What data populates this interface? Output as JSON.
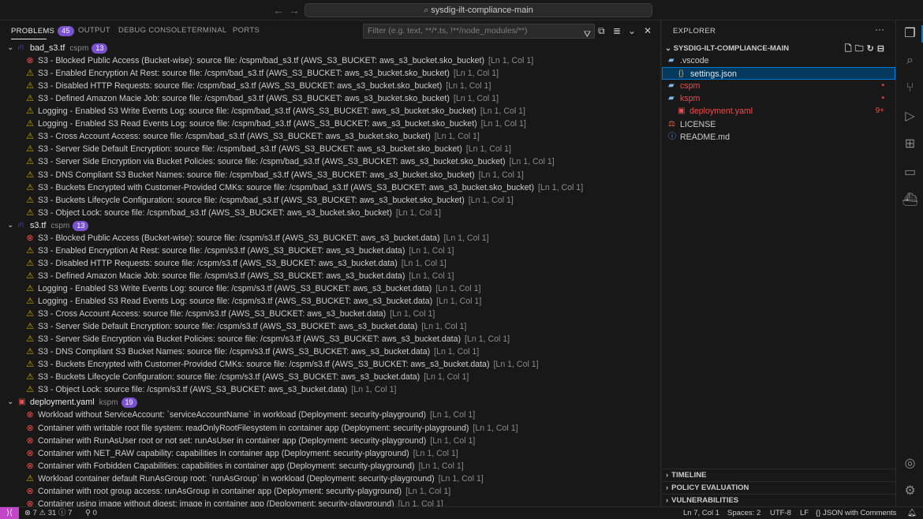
{
  "title_bar": {
    "back_label": "←",
    "forward_label": "→",
    "search_text": "sysdig-ilt-compliance-main"
  },
  "panel": {
    "tabs": [
      {
        "label": "PROBLEMS",
        "badge": "45"
      },
      {
        "label": "OUTPUT"
      },
      {
        "label": "DEBUG CONSOLE"
      },
      {
        "label": "TERMINAL"
      },
      {
        "label": "PORTS"
      }
    ],
    "filter_placeholder": "Filter (e.g. text, **/*.ts, !**/node_modules/**)",
    "groups": [
      {
        "file": "bad_s3.tf",
        "dir": "cspm",
        "count": "13",
        "items": [
          {
            "severity": "error",
            "message": "S3 - Blocked Public Access (Bucket-wise): source file: /cspm/bad_s3.tf (AWS_S3_BUCKET: aws_s3_bucket.sko_bucket)",
            "location": "[Ln 1, Col 1]"
          },
          {
            "severity": "warning",
            "message": "S3 - Enabled Encryption At Rest: source file: /cspm/bad_s3.tf (AWS_S3_BUCKET: aws_s3_bucket.sko_bucket)",
            "location": "[Ln 1, Col 1]"
          },
          {
            "severity": "warning",
            "message": "S3 - Disabled HTTP Requests: source file: /cspm/bad_s3.tf (AWS_S3_BUCKET: aws_s3_bucket.sko_bucket)",
            "location": "[Ln 1, Col 1]"
          },
          {
            "severity": "warning",
            "message": "S3 - Defined Amazon Macie Job: source file: /cspm/bad_s3.tf (AWS_S3_BUCKET: aws_s3_bucket.sko_bucket)",
            "location": "[Ln 1, Col 1]"
          },
          {
            "severity": "warning",
            "message": "Logging - Enabled S3 Write Events Log: source file: /cspm/bad_s3.tf (AWS_S3_BUCKET: aws_s3_bucket.sko_bucket)",
            "location": "[Ln 1, Col 1]"
          },
          {
            "severity": "warning",
            "message": "Logging - Enabled S3 Read Events Log: source file: /cspm/bad_s3.tf (AWS_S3_BUCKET: aws_s3_bucket.sko_bucket)",
            "location": "[Ln 1, Col 1]"
          },
          {
            "severity": "warning",
            "message": "S3 - Cross Account Access: source file: /cspm/bad_s3.tf (AWS_S3_BUCKET: aws_s3_bucket.sko_bucket)",
            "location": "[Ln 1, Col 1]"
          },
          {
            "severity": "warning",
            "message": "S3 - Server Side Default Encryption: source file: /cspm/bad_s3.tf (AWS_S3_BUCKET: aws_s3_bucket.sko_bucket)",
            "location": "[Ln 1, Col 1]"
          },
          {
            "severity": "warning",
            "message": "S3 - Server Side Encryption via Bucket Policies: source file: /cspm/bad_s3.tf (AWS_S3_BUCKET: aws_s3_bucket.sko_bucket)",
            "location": "[Ln 1, Col 1]"
          },
          {
            "severity": "warning",
            "message": "S3 - DNS Compliant S3 Bucket Names: source file: /cspm/bad_s3.tf (AWS_S3_BUCKET: aws_s3_bucket.sko_bucket)",
            "location": "[Ln 1, Col 1]"
          },
          {
            "severity": "warning",
            "message": "S3 - Buckets Encrypted with Customer-Provided CMKs: source file: /cspm/bad_s3.tf (AWS_S3_BUCKET: aws_s3_bucket.sko_bucket)",
            "location": "[Ln 1, Col 1]"
          },
          {
            "severity": "warning",
            "message": "S3 - Buckets Lifecycle Configuration: source file: /cspm/bad_s3.tf (AWS_S3_BUCKET: aws_s3_bucket.sko_bucket)",
            "location": "[Ln 1, Col 1]"
          },
          {
            "severity": "warning",
            "message": "S3 - Object Lock: source file: /cspm/bad_s3.tf (AWS_S3_BUCKET: aws_s3_bucket.sko_bucket)",
            "location": "[Ln 1, Col 1]"
          }
        ]
      },
      {
        "file": "s3.tf",
        "dir": "cspm",
        "count": "13",
        "items": [
          {
            "severity": "error",
            "message": "S3 - Blocked Public Access (Bucket-wise): source file: /cspm/s3.tf (AWS_S3_BUCKET: aws_s3_bucket.data)",
            "location": "[Ln 1, Col 1]"
          },
          {
            "severity": "warning",
            "message": "S3 - Enabled Encryption At Rest: source file: /cspm/s3.tf (AWS_S3_BUCKET: aws_s3_bucket.data)",
            "location": "[Ln 1, Col 1]"
          },
          {
            "severity": "warning",
            "message": "S3 - Disabled HTTP Requests: source file: /cspm/s3.tf (AWS_S3_BUCKET: aws_s3_bucket.data)",
            "location": "[Ln 1, Col 1]"
          },
          {
            "severity": "warning",
            "message": "S3 - Defined Amazon Macie Job: source file: /cspm/s3.tf (AWS_S3_BUCKET: aws_s3_bucket.data)",
            "location": "[Ln 1, Col 1]"
          },
          {
            "severity": "warning",
            "message": "Logging - Enabled S3 Write Events Log: source file: /cspm/s3.tf (AWS_S3_BUCKET: aws_s3_bucket.data)",
            "location": "[Ln 1, Col 1]"
          },
          {
            "severity": "warning",
            "message": "Logging - Enabled S3 Read Events Log: source file: /cspm/s3.tf (AWS_S3_BUCKET: aws_s3_bucket.data)",
            "location": "[Ln 1, Col 1]"
          },
          {
            "severity": "warning",
            "message": "S3 - Cross Account Access: source file: /cspm/s3.tf (AWS_S3_BUCKET: aws_s3_bucket.data)",
            "location": "[Ln 1, Col 1]"
          },
          {
            "severity": "warning",
            "message": "S3 - Server Side Default Encryption: source file: /cspm/s3.tf (AWS_S3_BUCKET: aws_s3_bucket.data)",
            "location": "[Ln 1, Col 1]"
          },
          {
            "severity": "warning",
            "message": "S3 - Server Side Encryption via Bucket Policies: source file: /cspm/s3.tf (AWS_S3_BUCKET: aws_s3_bucket.data)",
            "location": "[Ln 1, Col 1]"
          },
          {
            "severity": "warning",
            "message": "S3 - DNS Compliant S3 Bucket Names: source file: /cspm/s3.tf (AWS_S3_BUCKET: aws_s3_bucket.data)",
            "location": "[Ln 1, Col 1]"
          },
          {
            "severity": "warning",
            "message": "S3 - Buckets Encrypted with Customer-Provided CMKs: source file: /cspm/s3.tf (AWS_S3_BUCKET: aws_s3_bucket.data)",
            "location": "[Ln 1, Col 1]"
          },
          {
            "severity": "warning",
            "message": "S3 - Buckets Lifecycle Configuration: source file: /cspm/s3.tf (AWS_S3_BUCKET: aws_s3_bucket.data)",
            "location": "[Ln 1, Col 1]"
          },
          {
            "severity": "warning",
            "message": "S3 - Object Lock: source file: /cspm/s3.tf (AWS_S3_BUCKET: aws_s3_bucket.data)",
            "location": "[Ln 1, Col 1]"
          }
        ]
      },
      {
        "file": "deployment.yaml",
        "dir": "kspm",
        "count": "19",
        "items": [
          {
            "severity": "error",
            "message": "Workload without ServiceAccount: `serviceAccountName` in workload (Deployment: security-playground)",
            "location": "[Ln 1, Col 1]"
          },
          {
            "severity": "error",
            "message": "Container with writable root file system: readOnlyRootFilesystem in container app (Deployment: security-playground)",
            "location": "[Ln 1, Col 1]"
          },
          {
            "severity": "error",
            "message": "Container with RunAsUser root or not set: runAsUser in container app (Deployment: security-playground)",
            "location": "[Ln 1, Col 1]"
          },
          {
            "severity": "error",
            "message": "Container with NET_RAW capability: capabilities in container app (Deployment: security-playground)",
            "location": "[Ln 1, Col 1]"
          },
          {
            "severity": "error",
            "message": "Container with Forbidden Capabilities: capabilities in container app (Deployment: security-playground)",
            "location": "[Ln 1, Col 1]"
          },
          {
            "severity": "warning",
            "message": "Workload container default RunAsGroup root: `runAsGroup` in workload (Deployment: security-playground)",
            "location": "[Ln 1, Col 1]"
          },
          {
            "severity": "error",
            "message": "Container with root group access: runAsGroup in container app (Deployment: security-playground)",
            "location": "[Ln 1, Col 1]"
          },
          {
            "severity": "error",
            "message": "Container using image without digest: image in container app (Deployment: security-playground)",
            "location": "[Ln 1, Col 1]"
          }
        ]
      }
    ]
  },
  "explorer": {
    "title": "EXPLORER",
    "more_label": "···",
    "root": "SYSDIG-ILT-COMPLIANCE-MAIN",
    "tree": [
      {
        "label": ".vscode",
        "kind": "folder-open",
        "depth": 0
      },
      {
        "label": "settings.json",
        "kind": "json",
        "depth": 1,
        "selected": true
      },
      {
        "label": "cspm",
        "kind": "folder",
        "depth": 0,
        "badge": "•",
        "color": "#f14c4c"
      },
      {
        "label": "kspm",
        "kind": "folder-open",
        "depth": 0,
        "badge": "•",
        "color": "#f14c4c"
      },
      {
        "label": "deployment.yaml",
        "kind": "yaml",
        "depth": 1,
        "badge": "9+",
        "color": "#f14c4c"
      },
      {
        "label": "LICENSE",
        "kind": "license",
        "depth": 0
      },
      {
        "label": "README.md",
        "kind": "info",
        "depth": 0
      }
    ],
    "sections": [
      "TIMELINE",
      "POLICY EVALUATION",
      "VULNERABILITIES"
    ]
  },
  "status_bar": {
    "errors": "7",
    "warnings": "31",
    "infos": "7",
    "ports": "0",
    "position": "Ln 7, Col 1",
    "spaces": "Spaces: 2",
    "encoding": "UTF-8",
    "eol": "LF",
    "language": "JSON with Comments"
  },
  "colors": {
    "accent": "#0078d4",
    "badge": "#7a52cf",
    "error": "#f14c4c",
    "warning": "#cca700",
    "remote": "#c147c8"
  }
}
